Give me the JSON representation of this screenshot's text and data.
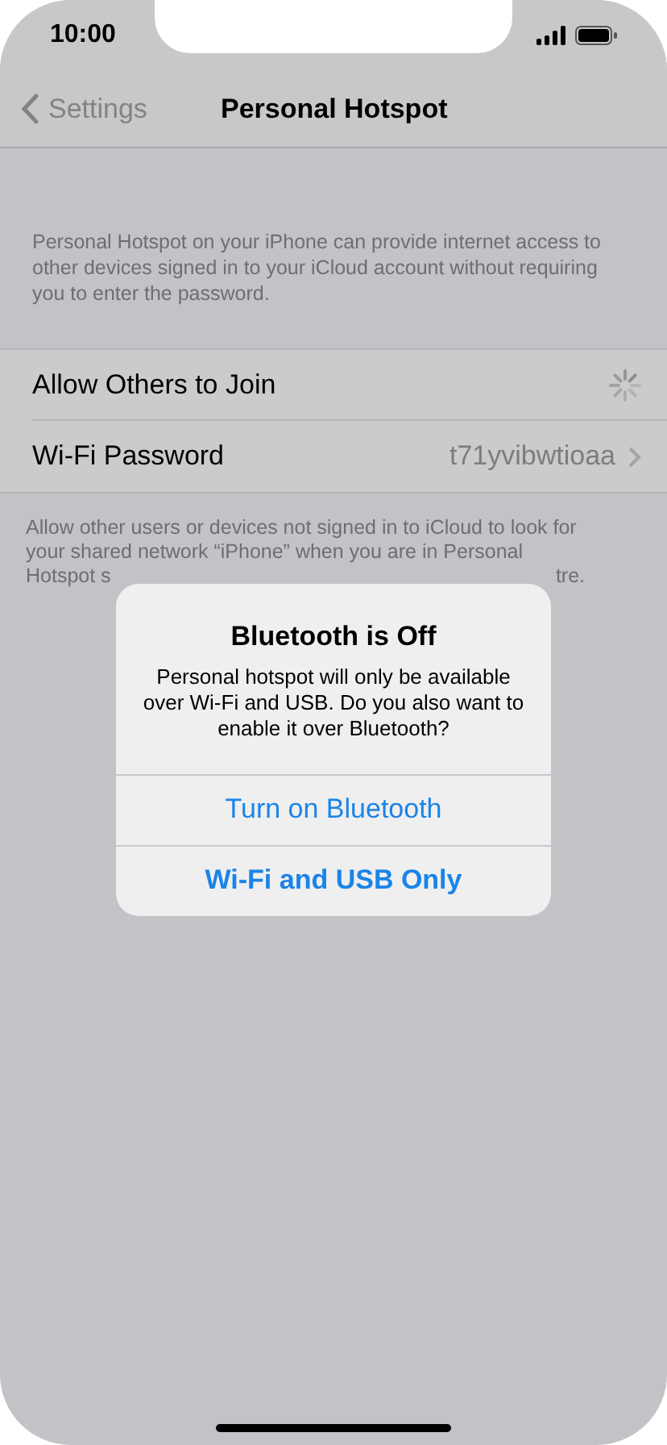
{
  "status_bar": {
    "time": "10:00"
  },
  "nav": {
    "back": "Settings",
    "title": "Personal Hotspot"
  },
  "header_note": "Personal Hotspot on your iPhone can provide internet access to other devices signed in to your iCloud account without requiring you to enter the password.",
  "rows": [
    {
      "kind": "spinner",
      "label": "Allow Others to Join"
    },
    {
      "kind": "value",
      "label": "Wi-Fi Password",
      "value": "t71yvibwtioaa"
    }
  ],
  "footer_note": {
    "lines": [
      "Allow other users or devices not signed in to iCloud to look for",
      "your shared network “iPhone” when you are in Personal"
    ],
    "last_line_start": "Hotspot s",
    "last_line_end": "tre."
  },
  "alert": {
    "title": "Bluetooth is Off",
    "message": "Personal hotspot will only be available over Wi-Fi and USB. Do you also want to enable it over Bluetooth?",
    "buttons": [
      {
        "label": "Turn on Bluetooth",
        "bold": false
      },
      {
        "label": "Wi-Fi and USB Only",
        "bold": true
      }
    ]
  }
}
